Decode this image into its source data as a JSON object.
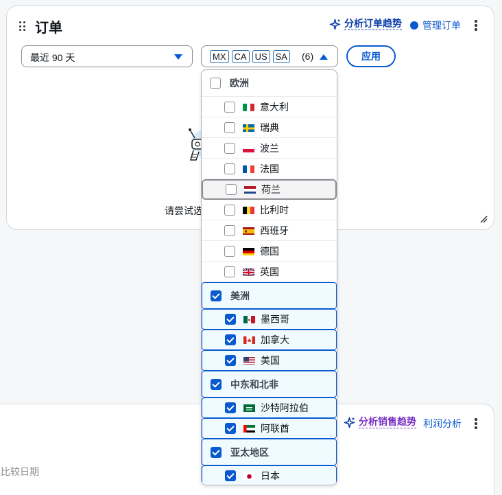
{
  "orders_card": {
    "title": "订单",
    "ai_link": "分析订单趋势",
    "manage_link": "管理订单",
    "date_select_value": "最近 90 天",
    "region_tokens": [
      "MX",
      "CA",
      "US",
      "SA"
    ],
    "region_count": "(6)",
    "apply_label": "应用",
    "empty_text": "请尝试选"
  },
  "sales_card": {
    "ai_link": "分析销售趋势",
    "profit_link": "利润分析",
    "compare_text": "比较日期"
  },
  "dropdown": {
    "options": [
      {
        "type": "group",
        "label": "欧洲",
        "checked": false
      },
      {
        "type": "item",
        "label": "意大利",
        "flag": "italy-flag-icon",
        "checked": false
      },
      {
        "type": "item",
        "label": "瑞典",
        "flag": "sweden-flag-icon",
        "checked": false
      },
      {
        "type": "item",
        "label": "波兰",
        "flag": "poland-flag-icon",
        "checked": false
      },
      {
        "type": "item",
        "label": "法国",
        "flag": "france-flag-icon",
        "checked": false
      },
      {
        "type": "item",
        "label": "荷兰",
        "flag": "netherlands-flag-icon",
        "checked": false
      },
      {
        "type": "item",
        "label": "比利时",
        "flag": "belgium-flag-icon",
        "checked": false
      },
      {
        "type": "item",
        "label": "西班牙",
        "flag": "spain-flag-icon",
        "checked": false
      },
      {
        "type": "item",
        "label": "德国",
        "flag": "germany-flag-icon",
        "checked": false
      },
      {
        "type": "item",
        "label": "英国",
        "flag": "uk-flag-icon",
        "checked": false
      },
      {
        "type": "group",
        "label": "美洲",
        "checked": true
      },
      {
        "type": "item",
        "label": "墨西哥",
        "flag": "mexico-flag-icon",
        "checked": true
      },
      {
        "type": "item",
        "label": "加拿大",
        "flag": "canada-flag-icon",
        "checked": true
      },
      {
        "type": "item",
        "label": "美国",
        "flag": "usa-flag-icon",
        "checked": true
      },
      {
        "type": "group",
        "label": "中东和北非",
        "checked": true
      },
      {
        "type": "item",
        "label": "沙特阿拉伯",
        "flag": "saudi-flag-icon",
        "checked": true
      },
      {
        "type": "item",
        "label": "阿联酋",
        "flag": "uae-flag-icon",
        "checked": true
      },
      {
        "type": "group",
        "label": "亚太地区",
        "checked": true
      },
      {
        "type": "item",
        "label": "日本",
        "flag": "japan-flag-icon",
        "checked": true
      }
    ]
  },
  "colors": {
    "accent": "#0a5acf",
    "ai_orders": "#0a3ca8",
    "ai_sales": "#7a2fc2",
    "selected_bg": "#f0fbff"
  }
}
